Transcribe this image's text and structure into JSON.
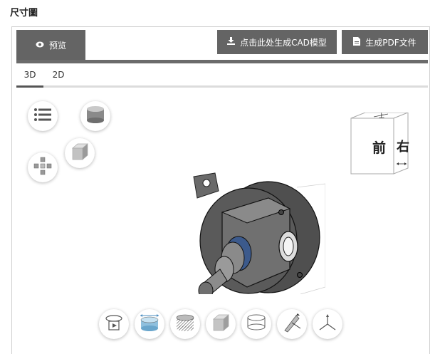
{
  "page": {
    "title": "尺寸圖"
  },
  "toolbar": {
    "preview_label": "预览",
    "cad_label": "点击此处生成CAD模型",
    "pdf_label": "生成PDF文件"
  },
  "view_tabs": [
    {
      "label": "3D",
      "active": true
    },
    {
      "label": "2D",
      "active": false
    }
  ],
  "viewcube": {
    "front": "前",
    "right": "右",
    "top": "上"
  },
  "left_tools": [
    {
      "icon": "list-icon"
    },
    {
      "icon": "cylinder-shaded-icon"
    },
    {
      "icon": "cube-shaded-icon"
    },
    {
      "icon": "explode-icon"
    }
  ],
  "bottom_tools": [
    {
      "icon": "rotate-play-icon"
    },
    {
      "icon": "section-dimension-icon"
    },
    {
      "icon": "hatched-cylinder-icon"
    },
    {
      "icon": "solid-cube-icon"
    },
    {
      "icon": "wireframe-cylinder-icon"
    },
    {
      "icon": "measure-angle-icon"
    },
    {
      "icon": "axes-icon"
    }
  ]
}
